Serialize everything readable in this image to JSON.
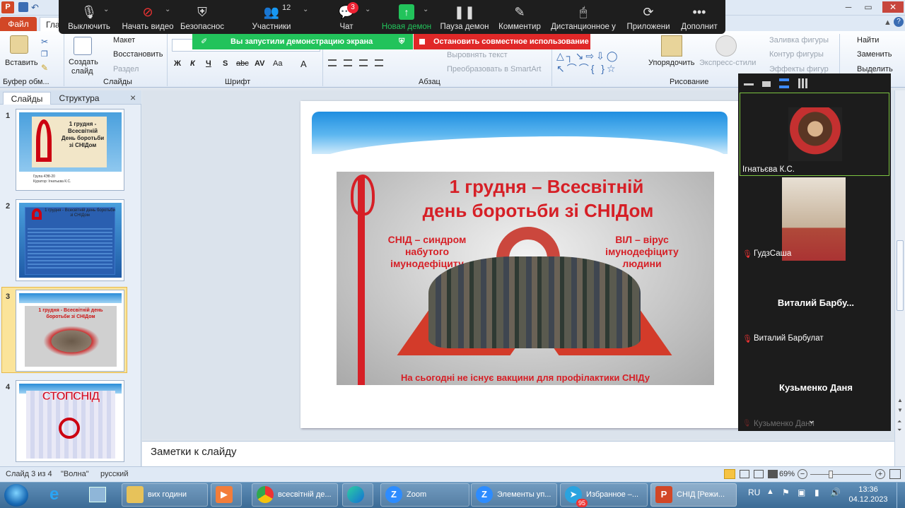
{
  "window": {
    "title": "",
    "file_tab": "Файл",
    "home_tab_fragment": "Гла"
  },
  "zoom_toolbar": {
    "mute": "Выключить",
    "video": "Начать видео",
    "security": "Безопаснос",
    "participants": "Участники",
    "participants_count": "12",
    "chat": "Чат",
    "chat_badge": "3",
    "new_share": "Новая демон",
    "pause_share": "Пауза демон",
    "annotate": "Комментир",
    "remote": "Дистанционное у",
    "apps": "Приложени",
    "more": "Дополнит"
  },
  "share_banner": {
    "text": "Вы запустили демонстрацию экрана",
    "stop": "Остановить совместное использование"
  },
  "ribbon": {
    "clipboard": {
      "paste": "Вставить",
      "label": "Буфер обм..."
    },
    "slides": {
      "new_slide": "Создать",
      "new_slide2": "слайд",
      "layout": "Макет",
      "reset": "Восстановить",
      "section": "Раздел",
      "label": "Слайды"
    },
    "font": {
      "label": "Шрифт",
      "bold": "Ж",
      "italic": "К",
      "underline": "Ч",
      "strike": "S",
      "abc": "abc",
      "spacing": "AV",
      "case": "Aa",
      "color": "A"
    },
    "paragraph": {
      "label": "Абзац",
      "text_direction": "Выровнять текст",
      "smartart": "Преобразовать в SmartArt"
    },
    "drawing": {
      "label": "Рисование",
      "arrange": "Упорядочить",
      "quick_styles": "Экспресс-стили",
      "fill": "Заливка фигуры",
      "outline": "Контур фигуры",
      "effects": "Эффекты фигур"
    },
    "editing": {
      "find": "Найти",
      "replace": "Заменить",
      "select": "Выделить"
    }
  },
  "left_pane": {
    "tab_slides": "Слайды",
    "tab_outline": "Структура",
    "close": "×",
    "slides": [
      {
        "num": "1",
        "title": "1 грудня - Всесвітній День боротьби зі СНІДом",
        "caption1": "Група 4Э8-20",
        "caption2": "Куратор: Ігнатьєва К.С."
      },
      {
        "num": "2",
        "title": "1 грудня - Всесвітній день боротьби зі СНІДом"
      },
      {
        "num": "3",
        "title": "1 грудня - Всесвітній день боротьби зі СНІДом"
      },
      {
        "num": "4",
        "title": "СТОПСНІД"
      }
    ]
  },
  "slide": {
    "heading1": "1 грудня – Всесвітній",
    "heading2": "день боротьби зі СНІДом",
    "left_text1": "СНІД – синдром",
    "left_text2": "набутого",
    "left_text3": "імунодефіциту",
    "right_text1": "ВІЛ – вірус",
    "right_text2": "імунодефіциту",
    "right_text3": "людини",
    "bottom_text": "На сьогодні не існує вакцини для профілактики СНІДу"
  },
  "notes": {
    "placeholder": "Заметки к слайду"
  },
  "participants": [
    {
      "name": "Ігнатьєва К.С.",
      "display": ""
    },
    {
      "name": "ГудзСаша",
      "display": ""
    },
    {
      "name": "Виталий Барбулат",
      "display": "Виталий  Барбу..."
    },
    {
      "name": "Кузьменко Даня",
      "display": "Кузьменко Даня"
    }
  ],
  "participant_partial": "Кузьменко Даня",
  "status": {
    "slide": "Слайд 3 из 4",
    "theme": "\"Волна\"",
    "lang": "русский",
    "zoom": "69%"
  },
  "taskbar": {
    "items": [
      "вих години",
      "всесвітній де...",
      "Zoom",
      "Элементы уп...",
      "Избранное –...",
      "СНІД [Режи..."
    ],
    "telegram_badge": "95",
    "lang": "RU",
    "time": "13:36",
    "date": "04.12.2023"
  },
  "colors": {
    "zoom_dark": "#1e1e1e",
    "share_green": "#22c35b",
    "stop_red": "#e02828",
    "ppt_orange": "#d24726",
    "active_border": "#7cc441"
  }
}
